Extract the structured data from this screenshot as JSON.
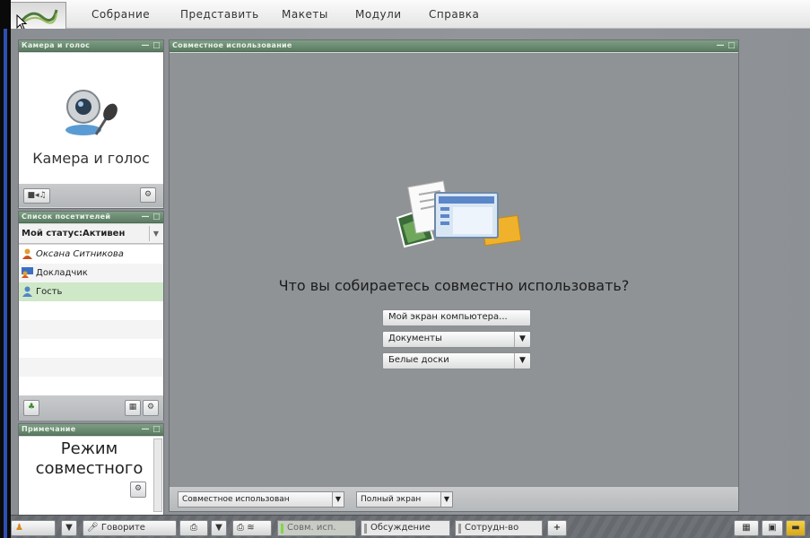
{
  "menu": {
    "items": [
      "Собрание",
      "Представить",
      "Макеты",
      "Модули",
      "Справка"
    ]
  },
  "camera_pod": {
    "title": "Камера и голос",
    "heading": "Камера и голос"
  },
  "attendee_pod": {
    "title": "Список посетителей",
    "status": "Мой статус:Активен",
    "attendees": [
      {
        "name": "Оксана Ситникова",
        "icon": "host-icon"
      },
      {
        "name": "Докладчик",
        "icon": "presenter-icon"
      },
      {
        "name": "Гость",
        "icon": "guest-icon"
      }
    ]
  },
  "note_pod": {
    "title": "Примечание",
    "text": "Режим совместного"
  },
  "share_pod": {
    "title": "Совместное использование",
    "question": "Что вы собираетесь совместно использовать?",
    "btn_screen": "Мой экран компьютера...",
    "btn_documents": "Документы",
    "btn_whiteboards": "Белые доски",
    "footer_mode": "Совместное использован",
    "footer_fullscreen": "Полный экран"
  },
  "bottombar": {
    "talk": "Говорите",
    "tabs": [
      "Совм. исп.",
      "Обсуждение",
      "Сотрудн-во"
    ],
    "add": "+"
  },
  "colors": {
    "pod_title": "#5a7a62",
    "workspace": "#909498",
    "selected_row": "#cfe8c8"
  }
}
